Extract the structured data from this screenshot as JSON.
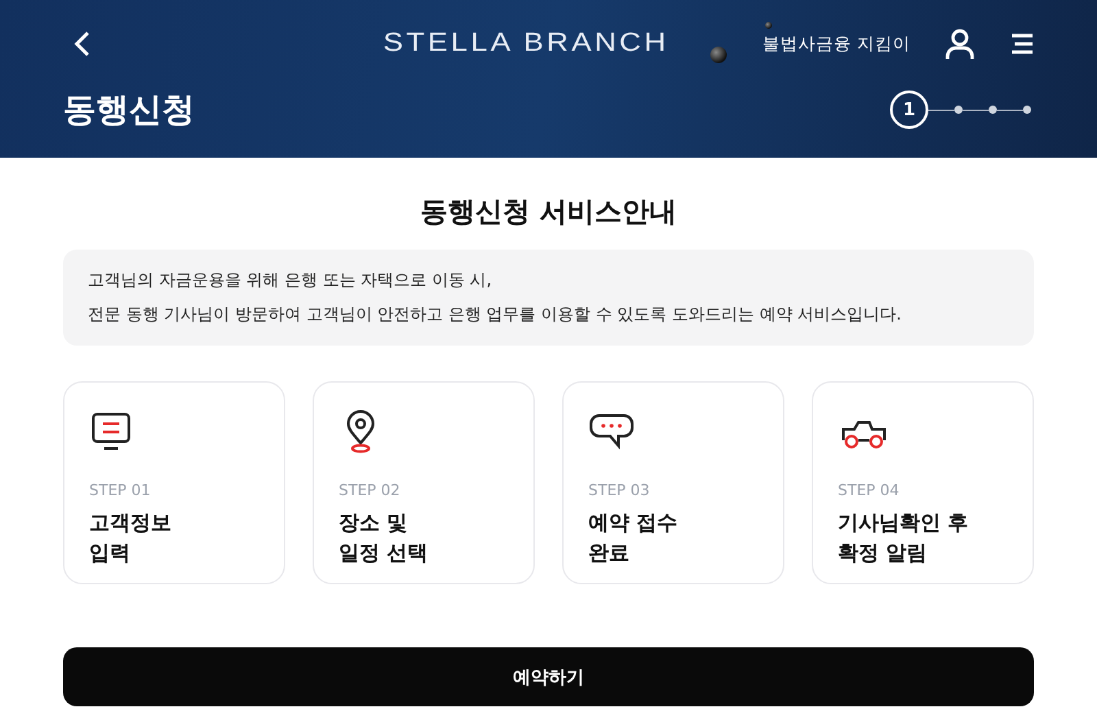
{
  "header": {
    "brand": "STELLA BRANCH",
    "link": "불법사금융 지킴이",
    "title": "동행신청",
    "progress": [
      {
        "label": "1",
        "selected": true
      },
      {
        "selected": false
      },
      {
        "selected": false
      },
      {
        "selected": false
      }
    ]
  },
  "intro": {
    "heading": "동행신청 서비스안내",
    "lines": [
      "고객님의 자금운용을 위해 은행 또는 자택으로 이동 시,",
      "전문 동행 기사님이 방문하여 고객님이 안전하고 은행 업무를 이용할 수 있도록 도와드리는 예약 서비스입니다."
    ]
  },
  "steps": [
    {
      "kind": "monitor",
      "step": "STEP 01",
      "title": "고객정보\n입력"
    },
    {
      "kind": "pin",
      "step": "STEP 02",
      "title": "장소 및\n일정 선택"
    },
    {
      "kind": "chat",
      "step": "STEP 03",
      "title": "예약 접수\n완료"
    },
    {
      "kind": "car",
      "step": "STEP 04",
      "title": "기사님확인 후\n확정 알림"
    }
  ],
  "button": "예약하기"
}
